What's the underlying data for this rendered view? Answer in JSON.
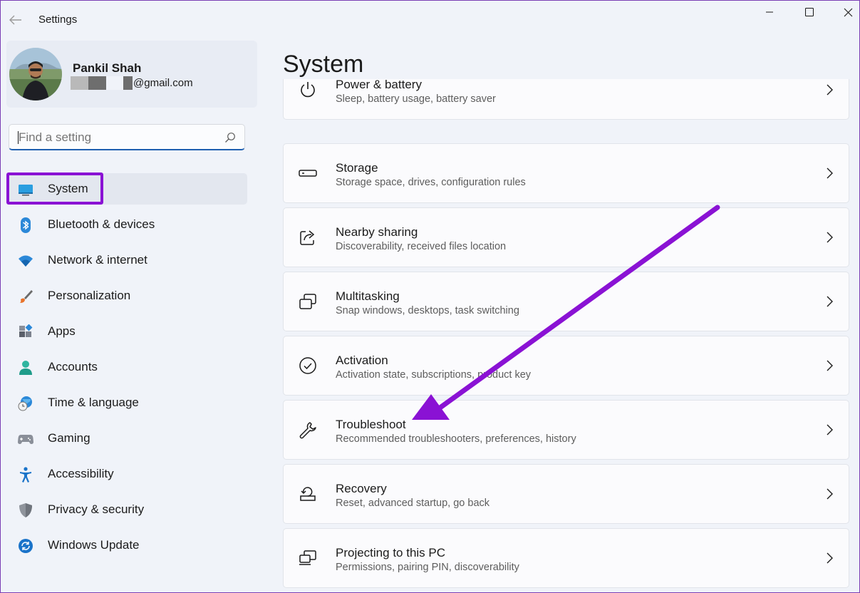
{
  "window": {
    "title": "Settings",
    "frame_color": "#7a3fb5"
  },
  "profile": {
    "name": "Pankil Shah",
    "email_suffix": "@gmail.com"
  },
  "search": {
    "placeholder": "Find a setting",
    "value": ""
  },
  "sidebar": {
    "items": [
      {
        "label": "System",
        "icon": "display-icon",
        "selected": true
      },
      {
        "label": "Bluetooth & devices",
        "icon": "bluetooth-icon"
      },
      {
        "label": "Network & internet",
        "icon": "wifi-icon"
      },
      {
        "label": "Personalization",
        "icon": "paintbrush-icon"
      },
      {
        "label": "Apps",
        "icon": "apps-icon"
      },
      {
        "label": "Accounts",
        "icon": "person-icon"
      },
      {
        "label": "Time & language",
        "icon": "globe-clock-icon"
      },
      {
        "label": "Gaming",
        "icon": "gamepad-icon"
      },
      {
        "label": "Accessibility",
        "icon": "accessibility-icon"
      },
      {
        "label": "Privacy & security",
        "icon": "shield-icon"
      },
      {
        "label": "Windows Update",
        "icon": "sync-icon"
      }
    ]
  },
  "main": {
    "title": "System",
    "cards": [
      {
        "title": "Power & battery",
        "subtitle": "Sleep, battery usage, battery saver",
        "icon": "power-icon"
      },
      {
        "title": "Storage",
        "subtitle": "Storage space, drives, configuration rules",
        "icon": "storage-drive-icon"
      },
      {
        "title": "Nearby sharing",
        "subtitle": "Discoverability, received files location",
        "icon": "share-icon"
      },
      {
        "title": "Multitasking",
        "subtitle": "Snap windows, desktops, task switching",
        "icon": "multitasking-icon"
      },
      {
        "title": "Activation",
        "subtitle": "Activation state, subscriptions, product key",
        "icon": "checkmark-circle-icon"
      },
      {
        "title": "Troubleshoot",
        "subtitle": "Recommended troubleshooters, preferences, history",
        "icon": "wrench-icon"
      },
      {
        "title": "Recovery",
        "subtitle": "Reset, advanced startup, go back",
        "icon": "recovery-icon"
      },
      {
        "title": "Projecting to this PC",
        "subtitle": "Permissions, pairing PIN, discoverability",
        "icon": "projecting-icon"
      }
    ]
  },
  "annotations": {
    "highlight_color": "#8a12d4",
    "arrow_color": "#8a12d4"
  }
}
